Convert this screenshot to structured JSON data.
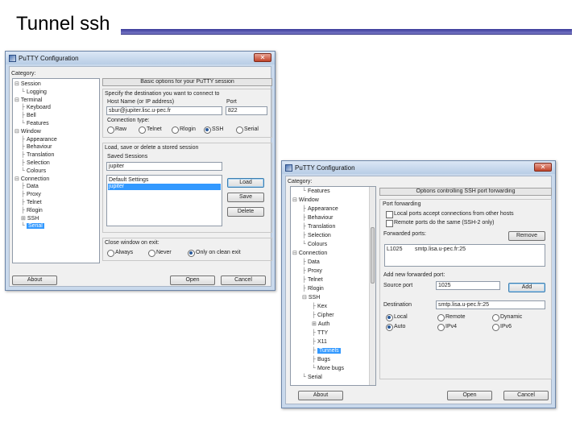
{
  "slide": {
    "title": "Tunnel ssh"
  },
  "window1": {
    "title": "PuTTY Configuration",
    "close_label": "✕",
    "category_label": "Category:",
    "tree": [
      {
        "label": "Session",
        "prefix": "⊟"
      },
      {
        "label": "Logging",
        "prefix": "└"
      },
      {
        "label": "Terminal",
        "prefix": "⊟"
      },
      {
        "label": "Keyboard",
        "prefix": "├"
      },
      {
        "label": "Bell",
        "prefix": "├"
      },
      {
        "label": "Features",
        "prefix": "└"
      },
      {
        "label": "Window",
        "prefix": "⊟"
      },
      {
        "label": "Appearance",
        "prefix": "├"
      },
      {
        "label": "Behaviour",
        "prefix": "├"
      },
      {
        "label": "Translation",
        "prefix": "├"
      },
      {
        "label": "Selection",
        "prefix": "├"
      },
      {
        "label": "Colours",
        "prefix": "└"
      },
      {
        "label": "Connection",
        "prefix": "⊟"
      },
      {
        "label": "Data",
        "prefix": "├"
      },
      {
        "label": "Proxy",
        "prefix": "├"
      },
      {
        "label": "Telnet",
        "prefix": "├"
      },
      {
        "label": "Rlogin",
        "prefix": "├"
      },
      {
        "label": "SSH",
        "prefix": "⊞"
      },
      {
        "label": "Serial",
        "prefix": "└"
      }
    ],
    "banner": "Basic options for your PuTTY session",
    "dest_label": "Specify the destination you want to connect to",
    "host_label": "Host Name (or IP address)",
    "port_label": "Port",
    "host_value": "sbur@jupiter.lisc.u-pec.fr",
    "port_value": "822",
    "conn_type_label": "Connection type:",
    "conn_types": [
      {
        "label": "Raw",
        "on": false
      },
      {
        "label": "Telnet",
        "on": false
      },
      {
        "label": "Rlogin",
        "on": false
      },
      {
        "label": "SSH",
        "on": true
      },
      {
        "label": "Serial",
        "on": false
      }
    ],
    "load_save_label": "Load, save or delete a stored session",
    "saved_sessions_label": "Saved Sessions",
    "saved_session_value": "jupiter",
    "sessions": [
      {
        "label": "Default Settings",
        "selected": false
      },
      {
        "label": "jupiter",
        "selected": true
      }
    ],
    "load_btn": "Load",
    "save_btn": "Save",
    "delete_btn": "Delete",
    "close_exit_label": "Close window on exit:",
    "close_options": [
      {
        "label": "Always",
        "on": false
      },
      {
        "label": "Never",
        "on": false
      },
      {
        "label": "Only on clean exit",
        "on": true
      }
    ],
    "about_btn": "About",
    "open_btn": "Open",
    "cancel_btn": "Cancel"
  },
  "window2": {
    "title": "PuTTY Configuration",
    "close_label": "✕",
    "category_label": "Category:",
    "tree": [
      {
        "label": "Features",
        "prefix": "└"
      },
      {
        "label": "Window",
        "prefix": "⊟"
      },
      {
        "label": "Appearance",
        "prefix": "├"
      },
      {
        "label": "Behaviour",
        "prefix": "├"
      },
      {
        "label": "Translation",
        "prefix": "├"
      },
      {
        "label": "Selection",
        "prefix": "├"
      },
      {
        "label": "Colours",
        "prefix": "└"
      },
      {
        "label": "Connection",
        "prefix": "⊟"
      },
      {
        "label": "Data",
        "prefix": "├"
      },
      {
        "label": "Proxy",
        "prefix": "├"
      },
      {
        "label": "Telnet",
        "prefix": "├"
      },
      {
        "label": "Rlogin",
        "prefix": "├"
      },
      {
        "label": "SSH",
        "prefix": "⊟"
      },
      {
        "label": "Kex",
        "prefix": "├"
      },
      {
        "label": "Cipher",
        "prefix": "├"
      },
      {
        "label": "Auth",
        "prefix": "⊞"
      },
      {
        "label": "TTY",
        "prefix": "├"
      },
      {
        "label": "X11",
        "prefix": "├"
      },
      {
        "label": "Tunnels",
        "prefix": "├"
      },
      {
        "label": "Bugs",
        "prefix": "├"
      },
      {
        "label": "More bugs",
        "prefix": "└"
      },
      {
        "label": "Serial",
        "prefix": "└"
      }
    ],
    "banner": "Options controlling SSH port forwarding",
    "port_fwd_label": "Port forwarding",
    "check_local": "Local ports accept connections from other hosts",
    "check_remote": "Remote ports do the same (SSH-2 only)",
    "forwarded_ports_label": "Forwarded ports:",
    "remove_btn": "Remove",
    "forwarded_entry_port": "L1025",
    "forwarded_entry_dest": "smtp.lisa.u-pec.fr:25",
    "add_new_label": "Add new forwarded port:",
    "source_port_label": "Source port",
    "source_port_value": "1025",
    "add_btn": "Add",
    "destination_label": "Destination",
    "destination_value": "smtp.lisa.u-pec.fr:25",
    "radio_row1": [
      {
        "label": "Local",
        "on": true
      },
      {
        "label": "Remote",
        "on": false
      },
      {
        "label": "Dynamic",
        "on": false
      }
    ],
    "radio_row2": [
      {
        "label": "Auto",
        "on": true
      },
      {
        "label": "IPv4",
        "on": false
      },
      {
        "label": "IPv6",
        "on": false
      }
    ],
    "about_btn": "About",
    "open_btn": "Open",
    "cancel_btn": "Cancel"
  }
}
